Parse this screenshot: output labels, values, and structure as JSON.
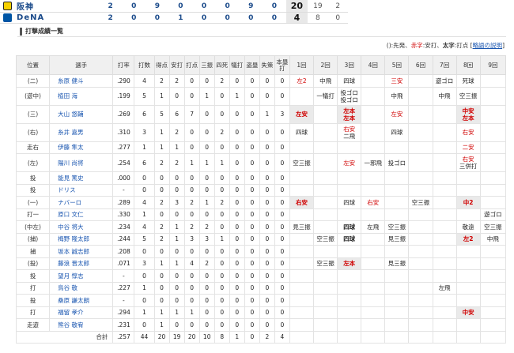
{
  "scoreboard": {
    "teams": [
      {
        "name": "阪神",
        "logo": "tigers-logo",
        "innings": [
          "2",
          "0",
          "9",
          "0",
          "0",
          "0",
          "9",
          "0"
        ],
        "runs": "20",
        "hits": "19",
        "errors": "2"
      },
      {
        "name": "DeNA",
        "logo": "baystars-logo",
        "innings": [
          "2",
          "0",
          "0",
          "1",
          "0",
          "0",
          "0",
          "0"
        ],
        "runs": "4",
        "hits": "8",
        "errors": "0"
      }
    ]
  },
  "section": {
    "title": "打撃成績一覧"
  },
  "legend": {
    "prefix": "():先発、",
    "red": "赤字",
    "mid": ":安打、",
    "bold": "太字",
    "rest": ":打点 [",
    "link": "略語の説明",
    "end": "]"
  },
  "headers": [
    "位置",
    "選手",
    "打率",
    "打数",
    "得点",
    "安打",
    "打点",
    "三振",
    "四死",
    "犠打",
    "盗塁",
    "失策",
    "本塁打",
    "1回",
    "2回",
    "3回",
    "4回",
    "5回",
    "6回",
    "7回",
    "8回",
    "9回"
  ],
  "colors": {
    "hit_red": "#d00000",
    "link_blue": "#1a56b0",
    "header_bg": "#f0f0f0",
    "highlight_bg": "#eaeaea"
  },
  "rows": [
    {
      "pos": "(二)",
      "name": "糸原 健斗",
      "stats": [
        ".290",
        "4",
        "2",
        "2",
        "0",
        "0",
        "2",
        "0",
        "0",
        "0",
        "0"
      ],
      "ab": [
        [
          {
            "t": "左2",
            "r": true
          }
        ],
        [
          {
            "t": "中飛"
          }
        ],
        [
          {
            "t": "四球"
          }
        ],
        [],
        [
          {
            "t": "三安",
            "r": true
          }
        ],
        [],
        [
          {
            "t": "遊ゴロ"
          }
        ],
        [
          {
            "t": "死球"
          }
        ],
        []
      ],
      "hl": []
    },
    {
      "pos": "(遊中)",
      "name": "植田 海",
      "stats": [
        ".199",
        "5",
        "1",
        "0",
        "0",
        "1",
        "0",
        "1",
        "0",
        "0",
        "0"
      ],
      "ab": [
        [],
        [
          {
            "t": "一犠打"
          }
        ],
        [
          {
            "t": "投ゴロ"
          },
          {
            "t": "投ゴロ"
          }
        ],
        [],
        [
          {
            "t": "中飛"
          }
        ],
        [],
        [
          {
            "t": "中飛"
          }
        ],
        [
          {
            "t": "空三振"
          }
        ],
        []
      ],
      "hl": []
    },
    {
      "pos": "(三)",
      "name": "大山 悠輔",
      "stats": [
        ".269",
        "6",
        "5",
        "6",
        "7",
        "0",
        "0",
        "0",
        "0",
        "1",
        "3"
      ],
      "ab": [
        [
          {
            "t": "左安",
            "r": true,
            "b": true
          }
        ],
        [],
        [
          {
            "t": "左本",
            "r": true,
            "b": true
          },
          {
            "t": "左本",
            "r": true,
            "b": true
          }
        ],
        [],
        [
          {
            "t": "左安",
            "r": true
          }
        ],
        [],
        [],
        [
          {
            "t": "中安",
            "r": true,
            "b": true
          },
          {
            "t": "左本",
            "r": true,
            "b": true
          }
        ],
        []
      ],
      "hl": [
        0,
        2,
        7
      ]
    },
    {
      "pos": "(右)",
      "name": "糸井 嘉男",
      "stats": [
        ".310",
        "3",
        "1",
        "2",
        "0",
        "0",
        "2",
        "0",
        "0",
        "0",
        "0"
      ],
      "ab": [
        [
          {
            "t": "四球"
          }
        ],
        [],
        [
          {
            "t": "右安",
            "r": true
          },
          {
            "t": "二飛"
          }
        ],
        [],
        [
          {
            "t": "四球"
          }
        ],
        [],
        [],
        [
          {
            "t": "右安",
            "r": true
          }
        ],
        []
      ],
      "hl": []
    },
    {
      "pos": "走右",
      "name": "伊藤 隼太",
      "stats": [
        ".277",
        "1",
        "1",
        "1",
        "0",
        "0",
        "0",
        "0",
        "0",
        "0",
        "0"
      ],
      "ab": [
        [],
        [],
        [],
        [],
        [],
        [],
        [],
        [
          {
            "t": "二安",
            "r": true
          }
        ],
        []
      ],
      "hl": []
    },
    {
      "pos": "(左)",
      "name": "陽川 尚将",
      "stats": [
        ".254",
        "6",
        "2",
        "2",
        "1",
        "1",
        "1",
        "0",
        "0",
        "0",
        "0"
      ],
      "ab": [
        [
          {
            "t": "空三振"
          }
        ],
        [],
        [
          {
            "t": "左安",
            "r": true
          }
        ],
        [
          {
            "t": "一邪飛"
          }
        ],
        [
          {
            "t": "投ゴロ"
          }
        ],
        [],
        [],
        [
          {
            "t": "右安",
            "r": true
          },
          {
            "t": "三併打"
          }
        ],
        []
      ],
      "hl": []
    },
    {
      "pos": "投",
      "name": "能見 篤史",
      "stats": [
        ".000",
        "0",
        "0",
        "0",
        "0",
        "0",
        "0",
        "0",
        "0",
        "0",
        "0"
      ],
      "ab": [
        [],
        [],
        [],
        [],
        [],
        [],
        [],
        [],
        []
      ],
      "hl": []
    },
    {
      "pos": "投",
      "name": "ドリス",
      "stats": [
        "-",
        "0",
        "0",
        "0",
        "0",
        "0",
        "0",
        "0",
        "0",
        "0",
        "0"
      ],
      "ab": [
        [],
        [],
        [],
        [],
        [],
        [],
        [],
        [],
        []
      ],
      "hl": []
    },
    {
      "pos": "(一)",
      "name": "ナバーロ",
      "stats": [
        ".289",
        "4",
        "2",
        "3",
        "2",
        "1",
        "2",
        "0",
        "0",
        "0",
        "0"
      ],
      "ab": [
        [
          {
            "t": "右安",
            "r": true,
            "b": true
          }
        ],
        [],
        [
          {
            "t": "四球"
          }
        ],
        [
          {
            "t": "右安",
            "r": true
          }
        ],
        [],
        [
          {
            "t": "空三振"
          }
        ],
        [],
        [
          {
            "t": "中2",
            "r": true,
            "b": true
          }
        ],
        []
      ],
      "hl": [
        0,
        7
      ]
    },
    {
      "pos": "打一",
      "name": "原口 文仁",
      "stats": [
        ".330",
        "1",
        "0",
        "0",
        "0",
        "0",
        "0",
        "0",
        "0",
        "0",
        "0"
      ],
      "ab": [
        [],
        [],
        [],
        [],
        [],
        [],
        [],
        [],
        [
          {
            "t": "遊ゴロ"
          }
        ]
      ],
      "hl": []
    },
    {
      "pos": "(中左)",
      "name": "中谷 将大",
      "stats": [
        ".234",
        "4",
        "2",
        "1",
        "2",
        "2",
        "0",
        "0",
        "0",
        "0",
        "0"
      ],
      "ab": [
        [
          {
            "t": "見三振"
          }
        ],
        [],
        [
          {
            "t": "四球",
            "b": true
          }
        ],
        [
          {
            "t": "左飛"
          }
        ],
        [
          {
            "t": "空三振"
          }
        ],
        [],
        [],
        [
          {
            "t": "敬遠"
          }
        ],
        [
          {
            "t": "空三振"
          }
        ]
      ],
      "hl": []
    },
    {
      "pos": "(捕)",
      "name": "梅野 隆太郎",
      "stats": [
        ".244",
        "5",
        "2",
        "1",
        "3",
        "3",
        "1",
        "0",
        "0",
        "0",
        "0"
      ],
      "ab": [
        [],
        [
          {
            "t": "空三振"
          }
        ],
        [
          {
            "t": "四球",
            "b": true
          }
        ],
        [],
        [
          {
            "t": "見三振"
          }
        ],
        [],
        [],
        [
          {
            "t": "左2",
            "r": true,
            "b": true
          }
        ],
        [
          {
            "t": "中飛"
          }
        ]
      ],
      "hl": [
        7
      ]
    },
    {
      "pos": "捕",
      "name": "坂本 誠志郎",
      "stats": [
        ".208",
        "0",
        "0",
        "0",
        "0",
        "0",
        "0",
        "0",
        "0",
        "0",
        "0"
      ],
      "ab": [
        [],
        [],
        [],
        [],
        [],
        [],
        [],
        [],
        []
      ],
      "hl": []
    },
    {
      "pos": "(投)",
      "name": "藤浪 晋太郎",
      "stats": [
        ".071",
        "3",
        "1",
        "1",
        "4",
        "2",
        "0",
        "0",
        "0",
        "0",
        "0"
      ],
      "ab": [
        [],
        [
          {
            "t": "空三振"
          }
        ],
        [
          {
            "t": "左本",
            "r": true,
            "b": true
          }
        ],
        [],
        [
          {
            "t": "見三振"
          }
        ],
        [],
        [],
        [],
        []
      ],
      "hl": [
        2
      ]
    },
    {
      "pos": "投",
      "name": "望月 惇志",
      "stats": [
        "-",
        "0",
        "0",
        "0",
        "0",
        "0",
        "0",
        "0",
        "0",
        "0",
        "0"
      ],
      "ab": [
        [],
        [],
        [],
        [],
        [],
        [],
        [],
        [],
        []
      ],
      "hl": []
    },
    {
      "pos": "打",
      "name": "鳥谷 敬",
      "stats": [
        ".227",
        "1",
        "0",
        "0",
        "0",
        "0",
        "0",
        "0",
        "0",
        "0",
        "0"
      ],
      "ab": [
        [],
        [],
        [],
        [],
        [],
        [],
        [
          {
            "t": "左飛"
          }
        ],
        [],
        []
      ],
      "hl": []
    },
    {
      "pos": "投",
      "name": "桑原 謙太朗",
      "stats": [
        "-",
        "0",
        "0",
        "0",
        "0",
        "0",
        "0",
        "0",
        "0",
        "0",
        "0"
      ],
      "ab": [
        [],
        [],
        [],
        [],
        [],
        [],
        [],
        [],
        []
      ],
      "hl": []
    },
    {
      "pos": "打",
      "name": "福留 孝介",
      "stats": [
        ".294",
        "1",
        "1",
        "1",
        "1",
        "0",
        "0",
        "0",
        "0",
        "0",
        "0"
      ],
      "ab": [
        [],
        [],
        [],
        [],
        [],
        [],
        [],
        [
          {
            "t": "中安",
            "r": true,
            "b": true
          }
        ],
        []
      ],
      "hl": [
        7
      ]
    },
    {
      "pos": "走遊",
      "name": "熊谷 敬宥",
      "stats": [
        ".231",
        "0",
        "1",
        "0",
        "0",
        "0",
        "0",
        "0",
        "0",
        "0",
        "0"
      ],
      "ab": [
        [],
        [],
        [],
        [],
        [],
        [],
        [],
        [],
        []
      ],
      "hl": []
    }
  ],
  "totals": {
    "label": "合計",
    "stats": [
      ".257",
      "44",
      "20",
      "19",
      "20",
      "10",
      "8",
      "1",
      "0",
      "2",
      "4"
    ]
  }
}
